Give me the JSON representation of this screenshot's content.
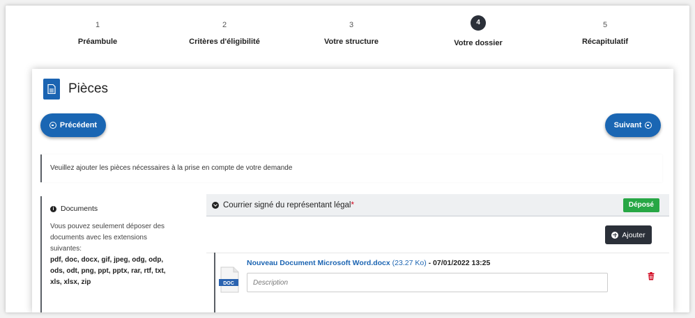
{
  "stepper": [
    {
      "num": "1",
      "label": "Préambule"
    },
    {
      "num": "2",
      "label": "Critères d'éligibilité"
    },
    {
      "num": "3",
      "label": "Votre structure"
    },
    {
      "num": "4",
      "label": "Votre dossier",
      "active": true
    },
    {
      "num": "5",
      "label": "Récapitulatif"
    }
  ],
  "page": {
    "title": "Pièces",
    "title_icon": "document-icon"
  },
  "nav": {
    "prev_label": "Précédent",
    "next_label": "Suivant"
  },
  "info_message": "Veuillez ajouter les pièces nécessaires à la prise en compte de votre demande",
  "docs_panel": {
    "heading": "Documents",
    "intro": "Vous pouvez seulement déposer des documents avec les extensions suivantes:",
    "extensions": "pdf, doc, docx, gif, jpeg, odg, odp, ods, odt, png, ppt, pptx, rar, rtf, txt, xls, xlsx, zip"
  },
  "section": {
    "title": "Courrier signé du représentant légal",
    "required_mark": "*",
    "status_badge": "Déposé",
    "add_label": "Ajouter"
  },
  "document": {
    "filename": "Nouveau Document Microsoft Word.docx",
    "size": "(23.27 Ko)",
    "date": "- 07/01/2022 13:25",
    "file_type": "DOC",
    "description_placeholder": "Description",
    "description_value": ""
  },
  "colors": {
    "primary": "#1a66b3",
    "dark": "#2b3039",
    "success": "#27a745",
    "danger": "#d0021b"
  }
}
